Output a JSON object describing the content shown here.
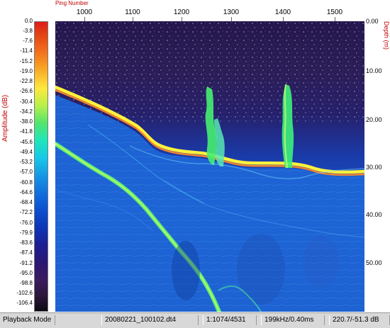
{
  "colorbar": {
    "title": "Amplitude (dB)",
    "ticks": [
      "0.0",
      "-3.8",
      "-7.6",
      "-11.4",
      "-15.2",
      "-19.0",
      "-22.8",
      "-26.6",
      "-30.4",
      "-34.2",
      "-38.0",
      "-41.8",
      "-45.6",
      "-49.4",
      "-53.2",
      "-57.0",
      "-60.8",
      "-64.6",
      "-68.4",
      "-72.2",
      "-76.0",
      "-79.9",
      "-83.6",
      "-87.4",
      "-91.2",
      "-95.0",
      "-98.8",
      "-102.6",
      "-106.4"
    ]
  },
  "x_axis": {
    "title": "Ping Number",
    "ticks": [
      "1000",
      "1100",
      "1200",
      "1300",
      "1400",
      "1500"
    ]
  },
  "y_axis": {
    "title": "Depth (m)",
    "ticks": [
      "0.00",
      "10.00",
      "20.00",
      "30.00",
      "40.00",
      "50.00"
    ]
  },
  "status_bar": {
    "mode": "Playback Mode",
    "file": "20080221_100102.dt4",
    "ping": "1:1074/4531",
    "frequency": "199kHz/0.40ms",
    "value": "220.7/-51.3 dB"
  }
}
